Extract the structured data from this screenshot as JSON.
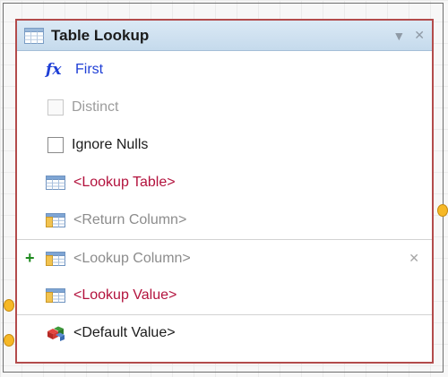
{
  "node": {
    "title": "Table Lookup",
    "header_icon": "table-icon",
    "dropdown_icon": "chevron-down-icon",
    "close_icon": "close-icon",
    "dropdown_glyph": "▼",
    "close_glyph": "✕"
  },
  "rows": {
    "function": {
      "icon": "fx-icon",
      "glyph": "fx",
      "label": "First"
    },
    "distinct": {
      "label": "Distinct",
      "checked": false,
      "enabled": false
    },
    "ignore_nulls": {
      "label": "Ignore Nulls",
      "checked": false,
      "enabled": true
    },
    "lookup_table": {
      "icon": "table-icon",
      "label": "<Lookup Table>"
    },
    "return_column": {
      "icon": "table-column-icon",
      "label": "<Return Column>"
    },
    "lookup_column": {
      "icon": "table-column-icon",
      "label": "<Lookup Column>",
      "add_glyph": "+",
      "remove_glyph": "✕"
    },
    "lookup_value": {
      "icon": "table-column-icon",
      "label": "<Lookup Value>"
    },
    "default_value": {
      "icon": "default-value-icon",
      "label": "<Default Value>"
    }
  },
  "colors": {
    "node_border": "#b34b4b",
    "header_bg": "#c5daec",
    "function_text": "#1f3fd6",
    "required_text": "#b3123d",
    "placeholder_text": "#8c8c8c",
    "connector": "#f6b826",
    "add_green": "#1f8a1f"
  }
}
